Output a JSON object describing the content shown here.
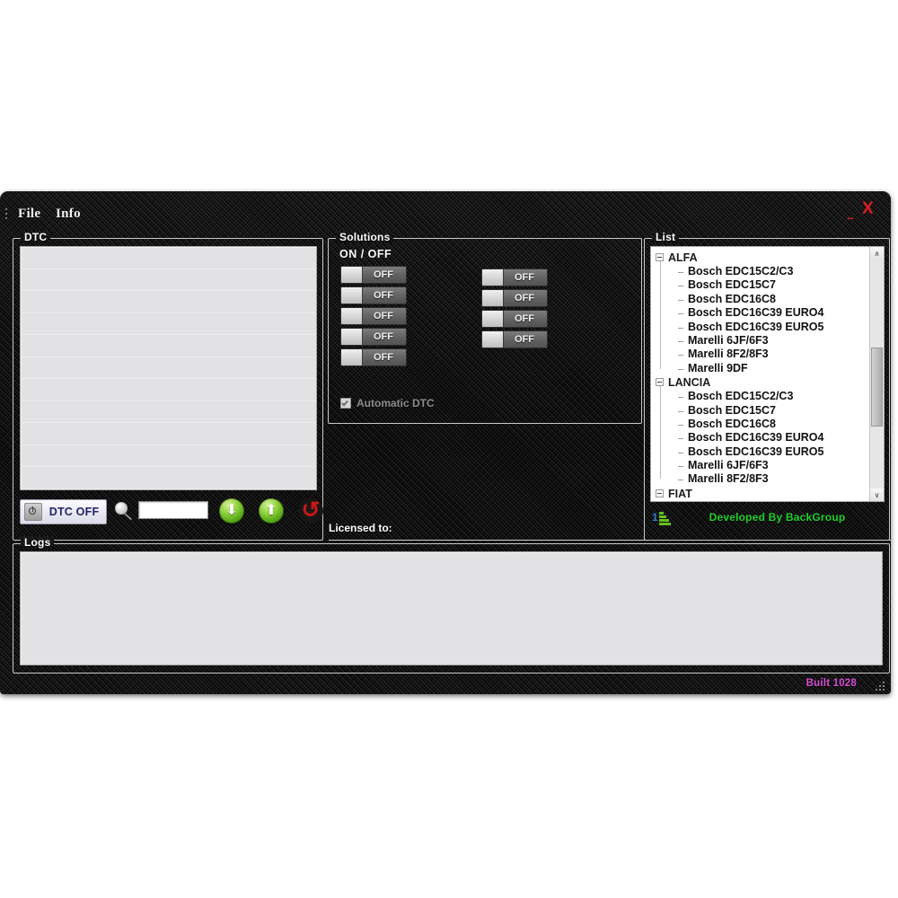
{
  "window": {
    "menu": [
      {
        "label": "File",
        "name": "menu-file"
      },
      {
        "label": "Info",
        "name": "menu-info"
      }
    ],
    "minimize_glyph": "–",
    "close_glyph": "X",
    "accent_close": "#d81f1f"
  },
  "dtc": {
    "title": "DTC",
    "rows": 11,
    "toolbar": {
      "dtc_off_label": "DTC OFF",
      "search_value": "",
      "search_placeholder": "",
      "download_glyph": "⬇",
      "upload_glyph": "⬆",
      "refresh_glyph": "↺"
    }
  },
  "solutions": {
    "title": "Solutions",
    "header": "ON  /  OFF",
    "toggles_left": [
      {
        "state": "OFF"
      },
      {
        "state": "OFF"
      },
      {
        "state": "OFF"
      },
      {
        "state": "OFF"
      },
      {
        "state": "OFF"
      }
    ],
    "toggles_right": [
      {
        "state": "OFF"
      },
      {
        "state": "OFF"
      },
      {
        "state": "OFF"
      },
      {
        "state": "OFF"
      }
    ],
    "automatic_dtc_label": "Automatic DTC",
    "automatic_dtc_checked": true
  },
  "licensed": {
    "label": "Licensed to:",
    "value": ""
  },
  "list": {
    "title": "List",
    "groups": [
      {
        "name": "ALFA",
        "children": [
          "Bosch EDC15C2/C3",
          "Bosch EDC15C7",
          "Bosch EDC16C8",
          "Bosch EDC16C39 EURO4",
          "Bosch EDC16C39 EURO5",
          "Marelli 6JF/6F3",
          "Marelli 8F2/8F3",
          "Marelli 9DF"
        ]
      },
      {
        "name": "LANCIA",
        "children": [
          "Bosch EDC15C2/C3",
          "Bosch EDC15C7",
          "Bosch EDC16C8",
          "Bosch EDC16C39 EURO4",
          "Bosch EDC16C39 EURO5",
          "Marelli 6JF/6F3",
          "Marelli 8F2/8F3"
        ]
      },
      {
        "name": "FIAT",
        "children": []
      }
    ],
    "scrollbar": {
      "up_glyph": "∧",
      "down_glyph": "∨"
    },
    "footer": {
      "stats_numeral": "1",
      "developed_by": "Developed By BackGroup",
      "developed_by_color": "#22d12b"
    }
  },
  "logs": {
    "title": "Logs",
    "content": ""
  },
  "status": {
    "built": "Built 1028",
    "built_color": "#d94fd9"
  }
}
